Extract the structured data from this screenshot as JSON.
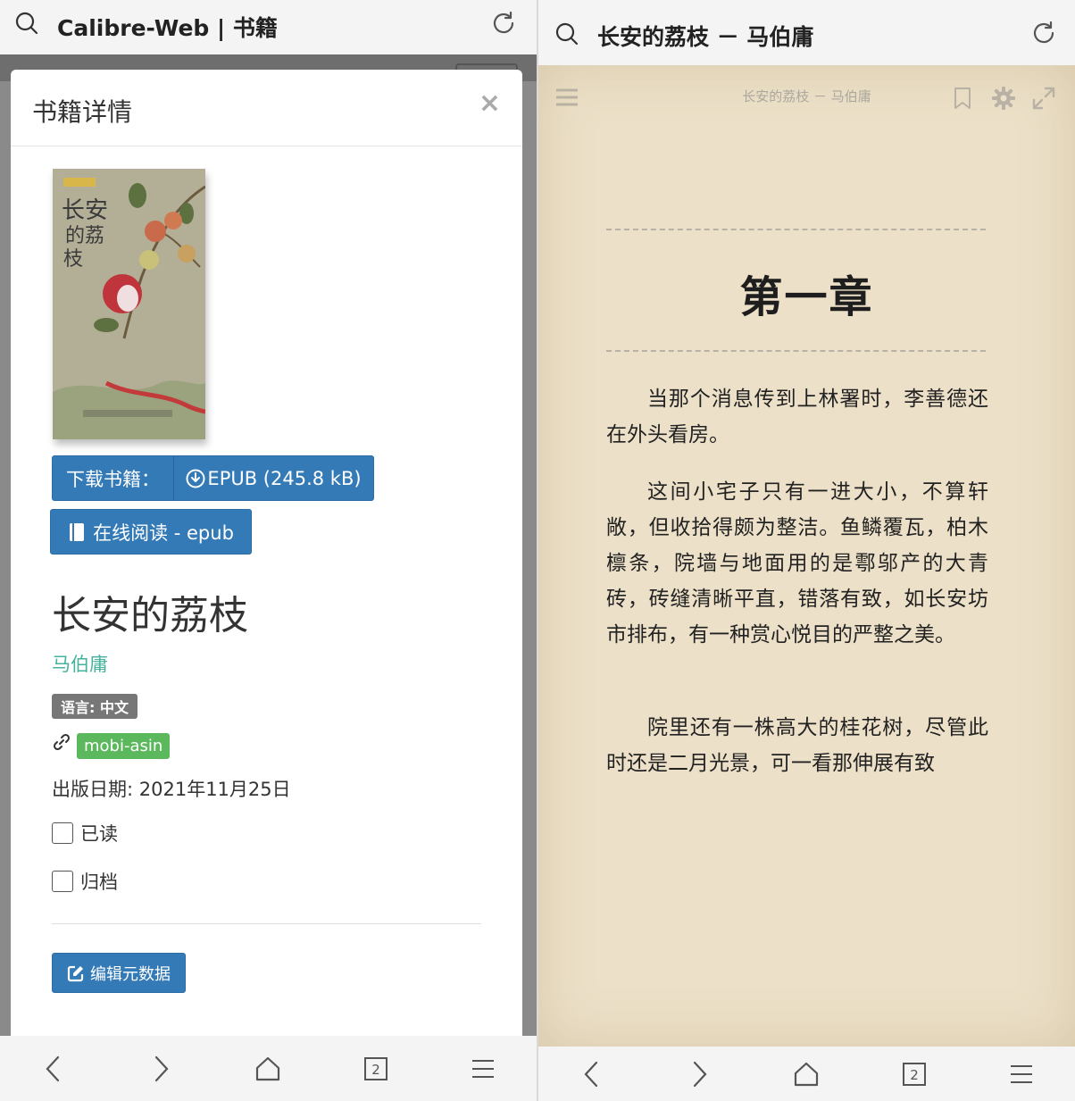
{
  "left": {
    "address_bar": {
      "title": "Calibre-Web | 书籍"
    },
    "modal": {
      "title": "书籍详情",
      "close": "×",
      "download_label": "下载书籍：",
      "download_format": "EPUB (245.8 kB)",
      "read_button": "在线阅读 - epub",
      "book_title": "长安的荔枝",
      "author": "马伯庸",
      "language_badge": "语言: 中文",
      "identifier_badge": "mobi-asin",
      "publish_date": "出版日期: 2021年11月25日",
      "checkbox_read": "已读",
      "checkbox_archived": "归档",
      "edit_button": "编辑元数据"
    },
    "bottom_nav": {
      "tabs_count": "2"
    }
  },
  "right": {
    "address_bar": {
      "title": "长安的荔枝 － 马伯庸"
    },
    "reader": {
      "header_meta": "长安的荔枝 － 马伯庸",
      "chapter_title": "第一章",
      "paragraphs": [
        "当那个消息传到上林署时，李善德还在外头看房。",
        "这间小宅子只有一进大小，不算轩敞，但收拾得颇为整洁。鱼鳞覆瓦，柏木檩条，院墙与地面用的是鄠邬产的大青砖，砖缝清晰平直，错落有致，如长安坊市排布，有一种赏心悦目的严整之美。",
        "院里还有一株高大的桂花树，尽管此时还是二月光景，可一看那伸展有致"
      ]
    },
    "bottom_nav": {
      "tabs_count": "2"
    }
  },
  "colors": {
    "primary_button": "#337ab7",
    "author_link": "#45b29d",
    "badge_gray": "#777777",
    "badge_green": "#5cb85c",
    "reader_background": "#ece0c8"
  },
  "icons": [
    "search-icon",
    "reload-icon",
    "close-icon",
    "download-icon",
    "book-icon",
    "link-icon",
    "edit-icon",
    "menu-icon",
    "bookmark-icon",
    "gear-icon",
    "expand-icon",
    "back-icon",
    "forward-icon",
    "home-icon",
    "tabs-icon"
  ]
}
